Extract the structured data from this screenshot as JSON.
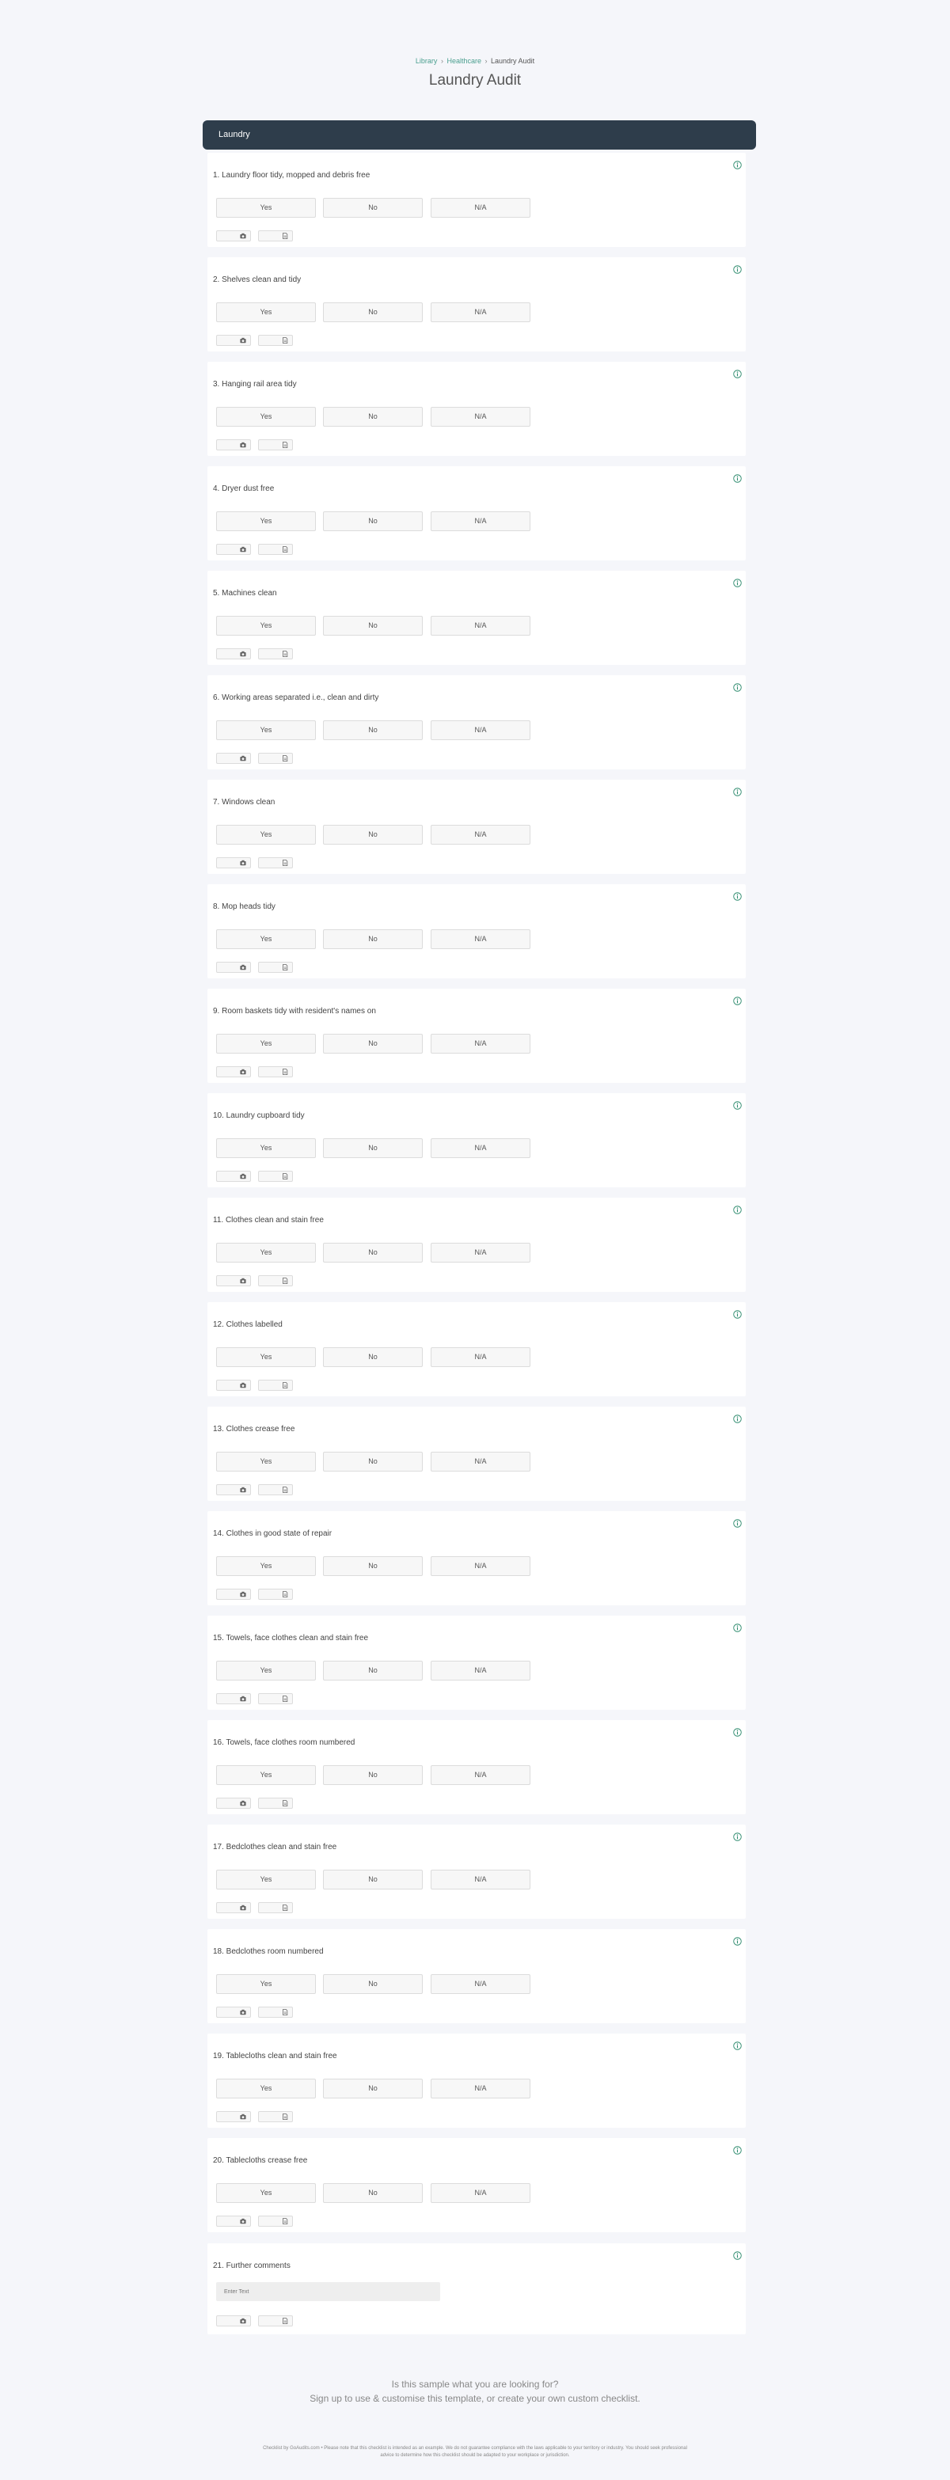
{
  "breadcrumb": {
    "items": [
      "Library",
      "Healthcare"
    ],
    "separator": "›",
    "current": "Laundry Audit"
  },
  "page_title": "Laundry Audit",
  "section": {
    "title": "Laundry"
  },
  "options": {
    "yes": "Yes",
    "no": "No",
    "na": "N/A"
  },
  "questions": [
    "1. Laundry floor tidy, mopped and debris free",
    "2. Shelves clean and tidy",
    "3. Hanging rail area tidy",
    "4. Dryer dust free",
    "5. Machines clean",
    "6. Working areas separated i.e., clean and dirty",
    "7. Windows clean",
    "8. Mop heads tidy",
    "9. Room baskets tidy with resident's names on",
    "10. Laundry cupboard tidy",
    "11. Clothes clean and stain free",
    "12. Clothes labelled",
    "13. Clothes crease free",
    "14. Clothes in good state of repair",
    "15. Towels, face clothes clean and stain free",
    "16. Towels, face clothes room numbered",
    "17. Bedclothes clean and stain free",
    "18. Bedclothes room numbered",
    "19. Tablecloths clean and stain free",
    "20. Tablecloths crease free"
  ],
  "comments": {
    "label": "21. Further comments",
    "placeholder": "Enter Text"
  },
  "icons": {
    "info": "info-icon",
    "camera": "camera-icon",
    "note": "note-icon"
  },
  "colors": {
    "accent": "#2e8b6e",
    "header_bg": "#2e3d4b",
    "link": "#4a9f8f"
  },
  "cta": {
    "line1": "Is this sample what you are looking for?",
    "line2": "Sign up to use & customise this template, or create your own custom checklist."
  },
  "footer": {
    "line1": "Checklist by GoAudits.com • Please note that this checklist is intended as an example. We do not guarantee compliance with the laws applicable to your territory or industry. You should seek professional",
    "line2": "advice to determine how this checklist should be adapted to your workplace or jurisdiction."
  }
}
